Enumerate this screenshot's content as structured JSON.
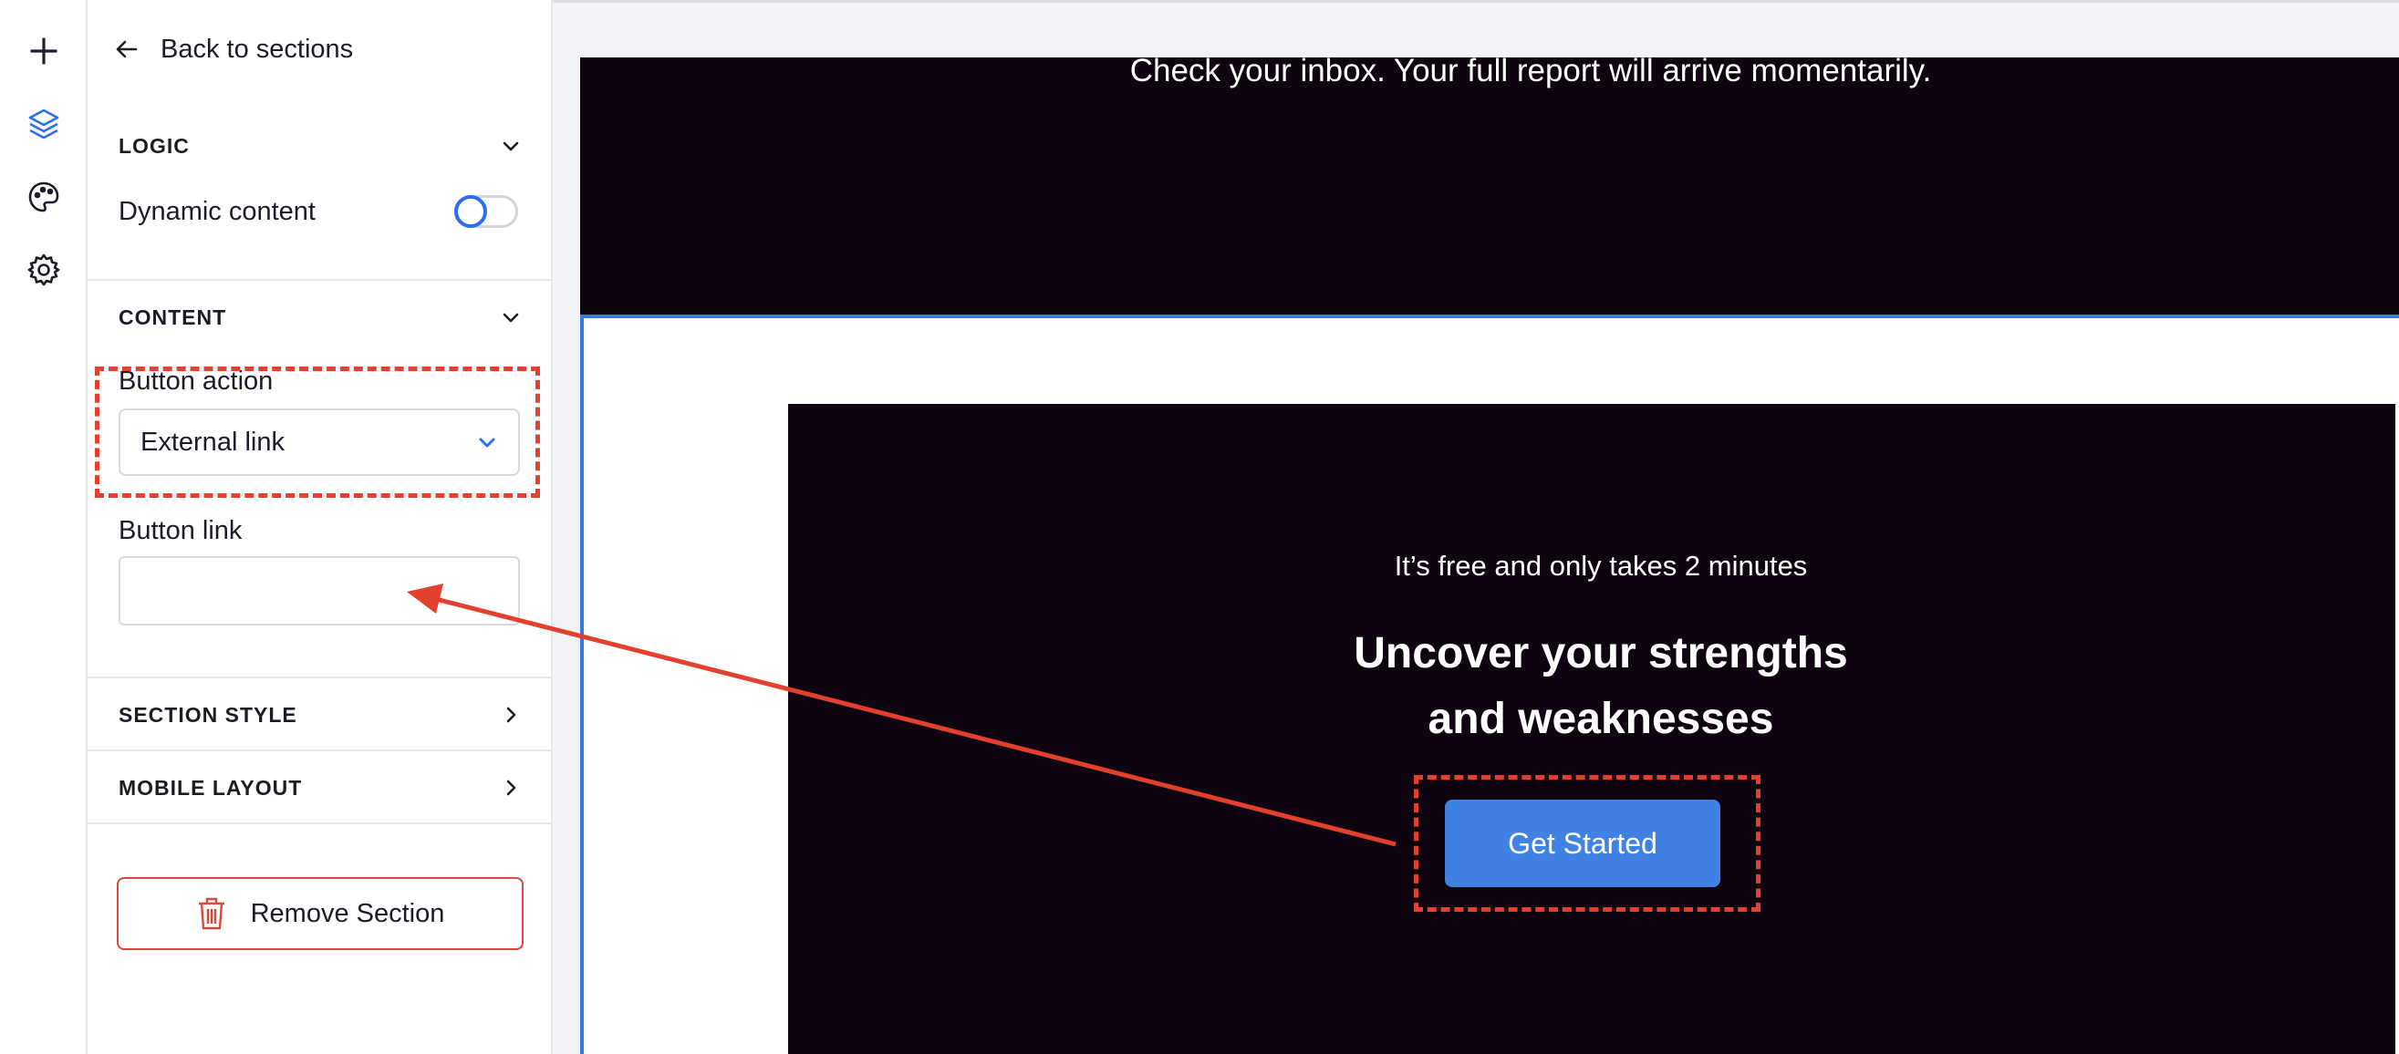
{
  "rail": {
    "icons": [
      "plus-icon",
      "layers-icon",
      "palette-icon",
      "gear-icon"
    ],
    "active_color": "#2b6ef0"
  },
  "panel": {
    "back_label": "Back to sections",
    "logic": {
      "title": "LOGIC",
      "dynamic_content_label": "Dynamic content",
      "dynamic_content_enabled": false
    },
    "content": {
      "title": "CONTENT",
      "button_action_label": "Button action",
      "button_action_value": "External link",
      "button_link_label": "Button link",
      "button_link_value": "",
      "button_link_placeholder": ""
    },
    "section_style_title": "SECTION STYLE",
    "mobile_layout_title": "MOBILE LAYOUT",
    "remove_label": "Remove Section"
  },
  "canvas": {
    "top_text": "Check your inbox.  Your full report will arrive momentarily.",
    "cta_subtitle": "It’s free and only takes 2 minutes",
    "cta_title_line1": "Uncover your strengths",
    "cta_title_line2": "and weaknesses",
    "cta_button": "Get Started"
  },
  "colors": {
    "accent": "#2b6ef0",
    "dark_section": "#0f0510",
    "cta_button": "#3f82e4",
    "annotation": "#e4402e",
    "danger": "#d9473b"
  }
}
